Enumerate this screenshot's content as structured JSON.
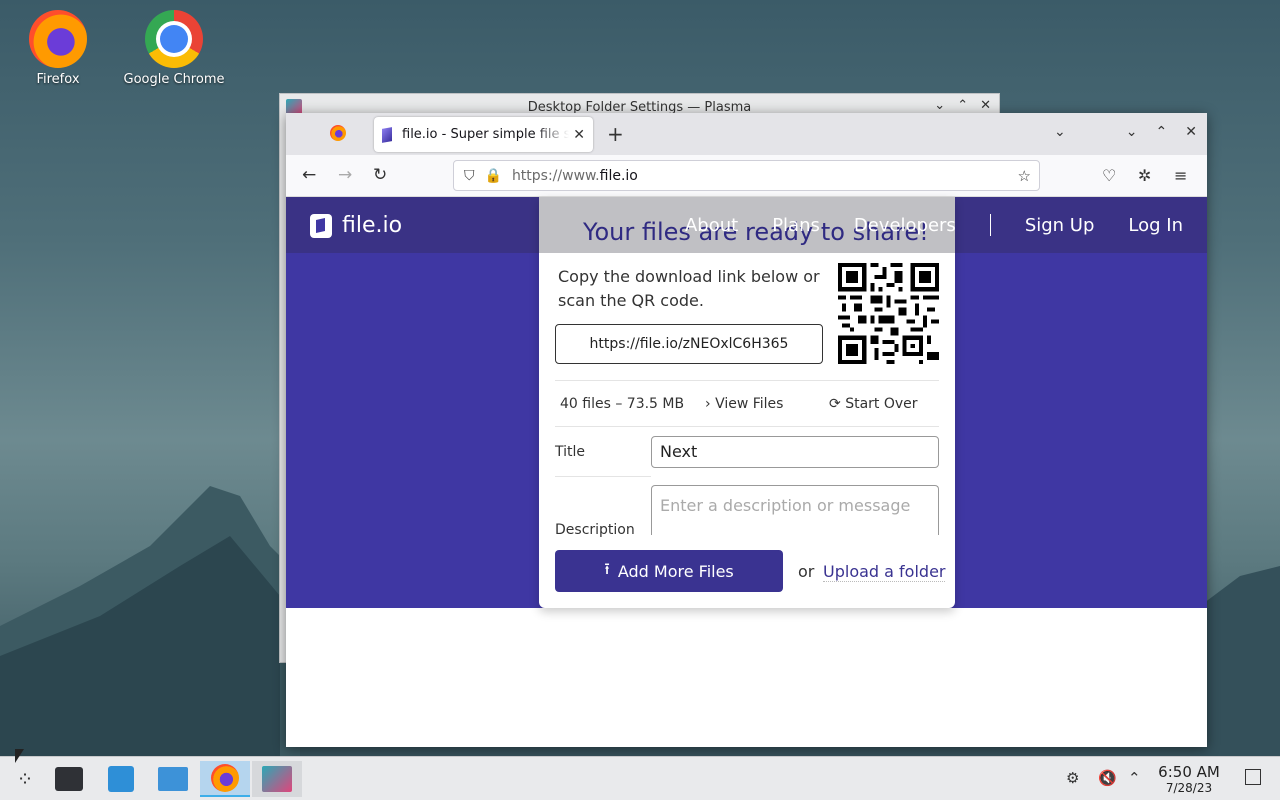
{
  "desktop": {
    "icons": [
      {
        "label": "Firefox",
        "icon": "firefox-icon"
      },
      {
        "label": "Google Chrome",
        "icon": "chrome-icon"
      }
    ]
  },
  "back_window": {
    "title": "Desktop Folder Settings — Plasma"
  },
  "browser": {
    "tab_title": "file.io - Super simple file sharing",
    "url_prefix": "https://www.",
    "url_domain": "file.io"
  },
  "site": {
    "logo_text": "file.io",
    "nav": {
      "about": "About",
      "plans": "Plans",
      "developers": "Developers",
      "sign_up": "Sign Up",
      "log_in": "Log In"
    },
    "card": {
      "heading": "Your files are ready to share!",
      "copy_text": "Copy the download link below or scan the QR code.",
      "link": "https://file.io/zNEOxlC6H365",
      "summary": "40 files – 73.5 MB",
      "view_files": "View Files",
      "start_over": "Start Over",
      "title_label": "Title",
      "title_value": "Next",
      "description_label": "Description",
      "description_placeholder": "Enter a description or message",
      "add_more": "Add More Files",
      "or": "or",
      "upload_folder": "Upload a folder"
    }
  },
  "taskbar": {
    "time": "6:50 AM",
    "date": "7/28/23"
  },
  "colors": {
    "brand": "#3f37a3",
    "header": "#3a3285",
    "button": "#3a3391"
  }
}
